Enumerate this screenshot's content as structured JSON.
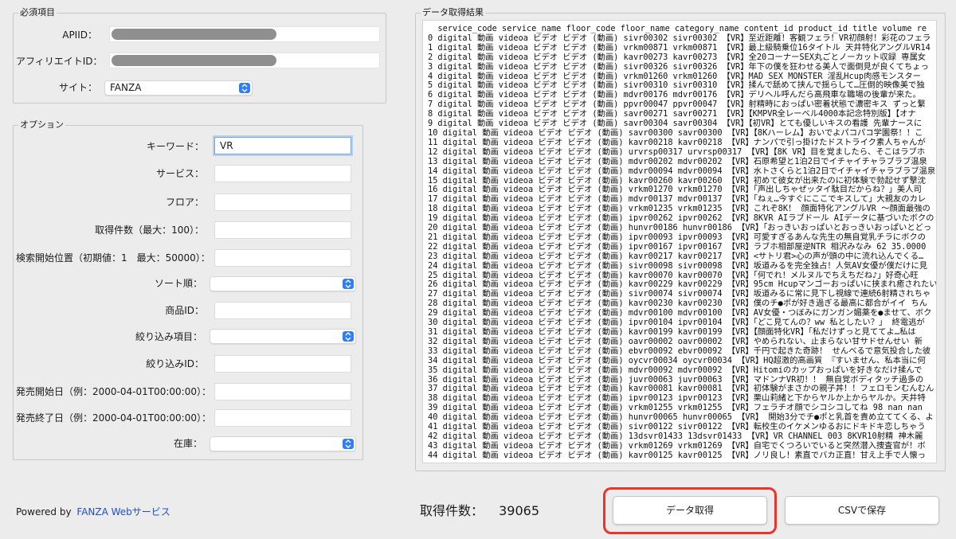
{
  "required": {
    "title": "必須項目",
    "apiid_label": "APIID：",
    "affiliate_label": "アフィリエイトID：",
    "site_label": "サイト：",
    "site_value": "FANZA"
  },
  "options": {
    "title": "オプション",
    "fields": [
      {
        "label": "キーワード：",
        "value": "VR"
      },
      {
        "label": "サービス：",
        "value": ""
      },
      {
        "label": "フロア：",
        "value": ""
      },
      {
        "label": "取得件数（最大：100）：",
        "value": ""
      },
      {
        "label": "検索開始位置（初期値：1　最大：50000）：",
        "value": ""
      },
      {
        "label": "ソート順：",
        "value": ""
      },
      {
        "label": "商品ID：",
        "value": ""
      },
      {
        "label": "絞り込み項目：",
        "value": ""
      },
      {
        "label": "絞り込みID：",
        "value": ""
      },
      {
        "label": "発売開始日（例：2000-04-01T00:00:00）：",
        "value": ""
      },
      {
        "label": "発売終了日（例：2000-04-01T00:00:00）：",
        "value": ""
      },
      {
        "label": "在庫：",
        "value": ""
      }
    ]
  },
  "footer": {
    "powered_by": "Powered by",
    "powered_link": "FANZA Webサービス",
    "count_label": "取得件数：",
    "count_value": "39065",
    "fetch_button": "データ取得",
    "csv_button": "CSVで保存"
  },
  "results": {
    "title": "データ取得結果",
    "lines": [
      "  service_code service_name floor_code floor_name category_name content_id product_id title volume re",
      "0 digital 動画 videoa ビデオ ビデオ (動画) sivr00302 sivr00302 【VR】至近距離！客観フェラ！VR初顔射！彩花のフェラ",
      "1 digital 動画 videoa ビデオ ビデオ (動画) vrkm00871 vrkm00871 【VR】最上級騎乗位16タイトル 天井特化アングルVR14",
      "2 digital 動画 videoa ビデオ ビデオ (動画) kavr00273 kavr00273 【VR】全20コーナーSEX丸ごとノーカット収録 専属女",
      "3 digital 動画 videoa ビデオ ビデオ (動画) sivr00326 sivr00326 【VR】年下の僕を狂わせる美人で面倒見が良くてちょっ",
      "4 digital 動画 videoa ビデオ ビデオ (動画) vrkm01260 vrkm01260 【VR】MAD SEX MONSTER 淫乱Hcup肉感モンスター",
      "5 digital 動画 videoa ビデオ ビデオ (動画) sivr00310 sivr00310 【VR】揉んで舐めて挟んで揺らして…圧倒的映像美で独",
      "6 digital 動画 videoa ビデオ ビデオ (動画) mdvr00176 mdvr00176 【VR】デリヘル呼んだら高飛車な職場の後輩が来た。",
      "7 digital 動画 videoa ビデオ ビデオ (動画) ppvr00047 ppvr00047 【VR】射精時におっぱい密着状態で濃密キス ずっと繋",
      "8 digital 動画 videoa ビデオ ビデオ (動画) savr00271 savr00271 【VR】【KMPVR全レーベル4000本記念特別版】【オナ",
      "9 digital 動画 videoa ビデオ ビデオ (動画) savr00304 savr00304 【VR】【初VR】とても優しいキスの看護 先輩ナースに",
      "10 digital 動画 videoa ビデオ ビデオ (動画) savr00300 savr00300 【VR】【8Kハーレム】おいでよパコパコ学園祭！！こ",
      "11 digital 動画 videoa ビデオ ビデオ (動画) kavr00218 kavr00218 【VR】ナンパで引っ掛けたドストライク素人ちゃんが",
      "12 digital 動画 videoa ビデオ ビデオ (動画) urvrsp00317 urvrsp00317 【VR】【8K VR】目を覚ましたら、そこはラブホ",
      "13 digital 動画 videoa ビデオ ビデオ (動画) mdvr00202 mdvr00202 【VR】石原希望と1泊2日でイチャイチャラブラブ温泉",
      "14 digital 動画 videoa ビデオ ビデオ (動画) mdvr00094 mdvr00094 【VR】水トさくらと1泊2日でイチャイチャラブラブ温泉",
      "15 digital 動画 videoa ビデオ ビデオ (動画) kavr00260 kavr00260 【VR】初めて彼女が出来たのに初体験で勃起せず撃沈",
      "16 digital 動画 videoa ビデオ ビデオ (動画) vrkm01270 vrkm01270 【VR】「声出しちゃぜッタイ駄目だからね？」美人司",
      "17 digital 動画 videoa ビデオ ビデオ (動画) mdvr00137 mdvr00137 【VR】「ねぇ…今すぐにここでキスして」大親友のカレ",
      "18 digital 動画 videoa ビデオ ビデオ (動画) vrkm01235 vrkm01235 【VR】これぞ8K！ 顔面特化アングルVR ～顔面最強の",
      "19 digital 動画 videoa ビデオ ビデオ (動画) ipvr00262 ipvr00262 【VR】8KVR AIラブドール AIデータに基づいたボクの",
      "20 digital 動画 videoa ビデオ ビデオ (動画) hunvr00186 hunvr00186 【VR】「おっきいおっぱいとおっきいおっぱいとどっ",
      "21 digital 動画 videoa ビデオ ビデオ (動画) ipvr00093 ipvr00093 【VR】可愛すぎるあんな先生の無自覚乳チラにボクの",
      "22 digital 動画 videoa ビデオ ビデオ (動画) ipvr00167 ipvr00167 【VR】ラブホ相部屋逆NTR 相沢みなみ 62 35.0000",
      "23 digital 動画 videoa ビデオ ビデオ (動画) kavr00217 kavr00217 【VR】<サトリ君>心の声が頭の中に流れ込んでくる…",
      "24 digital 動画 videoa ビデオ ビデオ (動画) sivr00098 sivr00098 【VR】坂道みるを完全独占！人気AV女優が僕だけに見",
      "25 digital 動画 videoa ビデオ ビデオ (動画) kavr00070 kavr00070 【VR】「何でれ！メルヌルでちえちだね♪」好奇心旺",
      "26 digital 動画 videoa ビデオ ビデオ (動画) kavr00229 kavr00229 【VR】95cm Hcupマンゴーおっぱいに挟まれ癒されたい",
      "27 digital 動画 videoa ビデオ ビデオ (動画) sivr00074 sivr00074 【VR】坂道みるに常に見下し視線で連続6射精されちゃ",
      "28 digital 動画 videoa ビデオ ビデオ (動画) kavr00230 kavr00230 【VR】僕のチ●ポが好き過ぎる最高に都合がイイ ちん",
      "29 digital 動画 videoa ビデオ ビデオ (動画) mdvr00100 mdvr00100 【VR】AV女優・つぼみにガンガン媚薬を●ませて、ボク",
      "30 digital 動画 videoa ビデオ ビデオ (動画) ipvr00104 ipvr00104 【VR】「どこ見てんの？ww 私としたい？」 終電逃が",
      "31 digital 動画 videoa ビデオ ビデオ (動画) kavr00199 kavr00199 【VR】【顔面特化VR】「私だけずっと見ててよ…私は",
      "32 digital 動画 videoa ビデオ ビデオ (動画) oavr00002 oavr00002 【VR】やめられない、止まらない甘サドせんせい 新",
      "33 digital 動画 videoa ビデオ ビデオ (動画) ebvr00092 ebvr00092 【VR】千円で起きた奇跡！ せんべるで意気投合した彼",
      "34 digital 動画 videoa ビデオ ビデオ (動画) oycvr00034 oycvr00034 【VR】HQ超激的高画質 『すいません、私本当に何",
      "35 digital 動画 videoa ビデオ ビデオ (動画) mdvr00092 mdvr00092 【VR】Hitomiのカップおっぱいを好きなだけ揉んで",
      "36 digital 動画 videoa ビデオ ビデオ (動画) juvr00063 juvr00063 【VR】マドンナVR初！！ 無自覚ボディタッチ過多の",
      "37 digital 動画 videoa ビデオ ビデオ (動画) kavr00081 kavr00081 【VR】初体験がまさかの親子丼！！フェロモンむんむん",
      "38 digital 動画 videoa ビデオ ビデオ (動画) ipvr00123 ipvr00123 【VR】栗山莉緒と下からヤルか上からヤルか。天井特",
      "39 digital 動画 videoa ビデオ ビデオ (動画) vrkm01255 vrkm01255 【VR】フェラチオ顔でシコシコしてね 98 nan nan",
      "40 digital 動画 videoa ビデオ ビデオ (動画) hunvr00065 hunvr00065 【VR】 開始3分でチ●ポと乳首を責め立ててくる、よ",
      "41 digital 動画 videoa ビデオ ビデオ (動画) sivr00122 sivr00122 【VR】転校生のイケメンゆるおにドキドキ恋しちゃう",
      "42 digital 動画 videoa ビデオ ビデオ (動画) 13dsvr01433 13dsvr01433 【VR】VR CHANNEL 003 8KVR10射精 神木麗",
      "43 digital 動画 videoa ビデオ ビデオ (動画) vrkm01269 vrkm01269 【VR】自宅でくつろいでいると突然潜入捜査官が！ボ",
      "44 digital 動画 videoa ビデオ ビデオ (動画) kavr00125 kavr00125 【VR】ノリ良し！素直でバカ正直！甘え上手で人懐っ"
    ]
  },
  "colors": {
    "accent": "#2f7ef5",
    "highlight": "#e8362b",
    "link": "#1f4fcf"
  },
  "icons": {
    "select_chevron": "chevron-updown-icon"
  }
}
